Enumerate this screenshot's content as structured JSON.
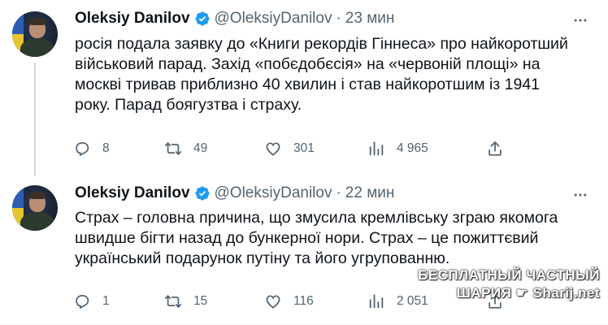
{
  "tweets": [
    {
      "author_name": "Oleksiy Danilov",
      "handle": "@OleksiyDanilov",
      "separator": "·",
      "time": "23 мин",
      "text": "росія подала заявку до «Книги рекордів Гіннеса» про найкоротший військовий парад. Захід «побєдобєсія» на «червоній площі» на москві тривав приблизно 40 хвилин і став найкоротшим із 1941 року. Парад боягузтва і страху.",
      "replies": "8",
      "retweets": "49",
      "likes": "301",
      "views": "4 965"
    },
    {
      "author_name": "Oleksiy Danilov",
      "handle": "@OleksiyDanilov",
      "separator": "·",
      "time": "22 мин",
      "text": "Страх – головна причина, що змусила кремлівську зграю якомога швидше бігти назад до бункерної нори. Страх – це пожиттєвий український подарунок путіну та його угрупованню.",
      "replies": "1",
      "retweets": "15",
      "likes": "116",
      "views": "2 051"
    }
  ],
  "icons": {
    "verified": "verified-badge-icon",
    "more": "more-icon",
    "reply": "reply-icon",
    "retweet": "retweet-icon",
    "like": "like-icon",
    "views": "views-icon",
    "share": "share-icon"
  },
  "colors": {
    "verified": "#1d9bf0",
    "secondary_text": "#536471",
    "primary_text": "#0f1419",
    "thread_line": "#cfd9de"
  },
  "watermark": {
    "line1": "БЕСПЛАТНЫЙ ЧАСТНЫЙ",
    "line2": "ШАРИЯ ☛ Sharij.net"
  }
}
